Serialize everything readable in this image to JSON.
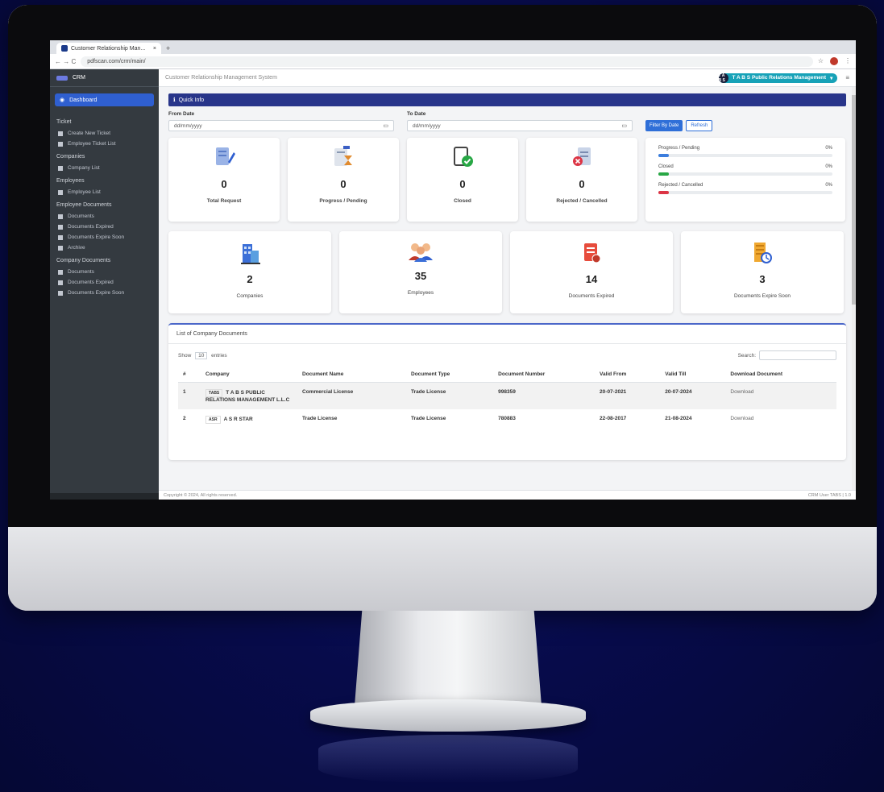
{
  "browser": {
    "tab_title": "Customer Relationship Man...",
    "tab_close": "×",
    "new_tab": "+",
    "nav": "←  →  C",
    "url": "pdfscan.com/crm/main/"
  },
  "sidebar": {
    "brand": "CRM",
    "active_item": "Dashboard",
    "sections": [
      {
        "header": "Ticket",
        "items": [
          "Create New Ticket",
          "Employee Ticket List"
        ]
      },
      {
        "header": "Companies",
        "items": [
          "Company List"
        ]
      },
      {
        "header": "Employees",
        "items": [
          "Employee List"
        ]
      },
      {
        "header": "Employee Documents",
        "items": [
          "Documents",
          "Documents Expired",
          "Documents Expire Soon",
          "Archive"
        ]
      },
      {
        "header": "Company Documents",
        "items": [
          "Documents",
          "Documents Expired",
          "Documents Expire Soon"
        ]
      }
    ]
  },
  "topnav": {
    "title": "Customer Relationship Management System",
    "company_badge": "T A B S",
    "company_name": "T A B S Public Relations Management",
    "menu": "≡"
  },
  "quick_info": "Quick Info",
  "filters": {
    "from_label": "From Date",
    "from_placeholder": "dd/mm/yyyy",
    "to_label": "To Date",
    "to_placeholder": "dd/mm/yyyy",
    "filter_btn": "Filter By Date",
    "refresh_btn": "Refresh"
  },
  "stats": [
    {
      "value": "0",
      "label": "Total Request"
    },
    {
      "value": "0",
      "label": "Progress / Pending"
    },
    {
      "value": "0",
      "label": "Closed"
    },
    {
      "value": "0",
      "label": "Rejected / Cancelled"
    }
  ],
  "progress": [
    {
      "label": "Progress / Pending",
      "percent": "0%",
      "fill": 0.06,
      "color": "#3b7ddd"
    },
    {
      "label": "Closed",
      "percent": "0%",
      "fill": 0.06,
      "color": "#28a745"
    },
    {
      "label": "Rejected / Cancelled",
      "percent": "0%",
      "fill": 0.06,
      "color": "#dc3545"
    }
  ],
  "stats2": [
    {
      "value": "2",
      "label": "Companies"
    },
    {
      "value": "35",
      "label": "Employees"
    },
    {
      "value": "14",
      "label": "Documents Expired"
    },
    {
      "value": "3",
      "label": "Documents Expire Soon"
    }
  ],
  "table": {
    "title": "List of Company Documents",
    "show": "Show",
    "entries_value": "10",
    "entries": "entries",
    "search_label": "Search:",
    "columns": [
      "#",
      "Company",
      "Document Name",
      "Document Type",
      "Document Number",
      "Valid From",
      "Valid Till",
      "Download Document"
    ],
    "rows": [
      {
        "num": "1",
        "logo": "TABS",
        "company": "T A B S PUBLIC RELATIONS MANAGEMENT L.L.C",
        "doc_name": "Commercial License",
        "doc_type": "Trade License",
        "doc_number": "998359",
        "valid_from": "20-07-2021",
        "valid_till": "20-07-2024",
        "download": "Download"
      },
      {
        "num": "2",
        "logo": "ASR",
        "company": "A S R STAR",
        "doc_name": "Trade License",
        "doc_type": "Trade License",
        "doc_number": "780883",
        "valid_from": "22-08-2017",
        "valid_till": "21-08-2024",
        "download": "Download"
      }
    ]
  },
  "footer": {
    "left": "Copyright © 2024, All rights reserved.",
    "right": "CRM User TABS | 1.0"
  }
}
